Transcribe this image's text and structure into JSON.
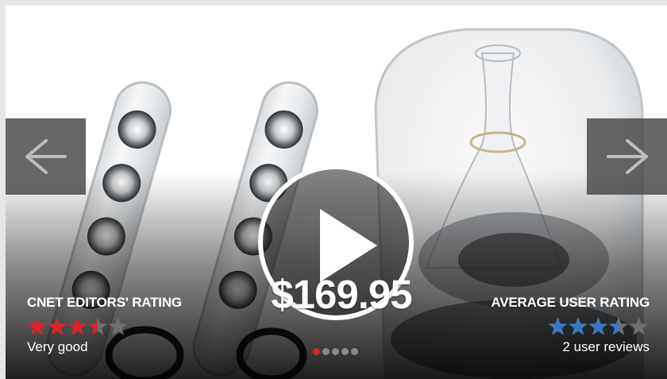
{
  "navigation": {
    "prev_icon": "arrow-left-icon",
    "next_icon": "arrow-right-icon"
  },
  "media": {
    "play_icon": "play-icon"
  },
  "price": "$169.95",
  "editors_rating": {
    "label": "CNET EDITORS' RATING",
    "stars": 3.5,
    "max_stars": 5,
    "text": "Very good",
    "color": "#d8232a"
  },
  "user_rating": {
    "label": "AVERAGE USER RATING",
    "stars": 3.5,
    "max_stars": 5,
    "reviews": "2 user reviews",
    "color": "#3a78c2"
  },
  "pagination": {
    "count": 5,
    "active_index": 0,
    "active_color": "#d8232a"
  }
}
